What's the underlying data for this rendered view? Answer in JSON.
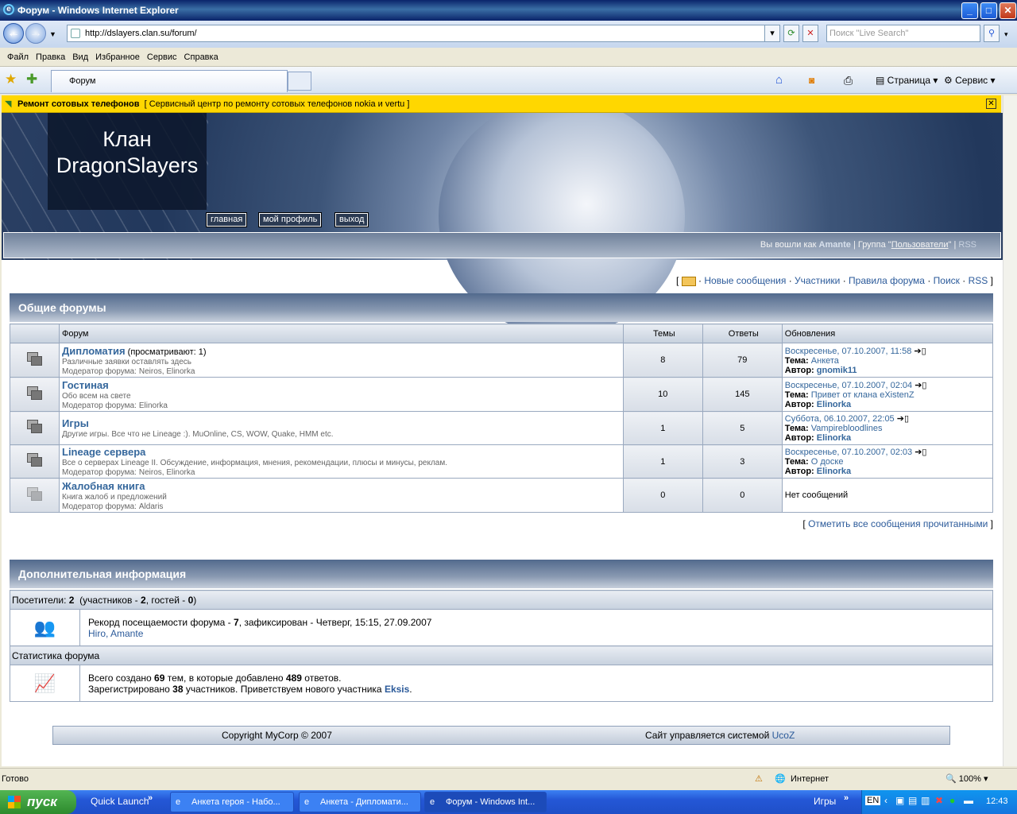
{
  "window": {
    "title": "Форум - Windows Internet Explorer"
  },
  "address": {
    "url": "http://dslayers.clan.su/forum/",
    "search_placeholder": "Поиск \"Live Search\""
  },
  "menu": [
    "Файл",
    "Правка",
    "Вид",
    "Избранное",
    "Сервис",
    "Справка"
  ],
  "tab": {
    "label": "Форум"
  },
  "toolbar": {
    "page": "Страница",
    "tools": "Сервис"
  },
  "infobar": {
    "title": "Ремонт сотовых телефонов",
    "text": "[ Сервисный центр по ремонту сотовых телефонов nokia и vertu ]"
  },
  "site": {
    "logo_line1": "Клан",
    "logo_line2": "DragonSlayers",
    "nav": [
      "главная",
      "мой профиль",
      "выход"
    ],
    "login_prefix": "Вы вошли как",
    "user": "Amante",
    "group_prefix": "| Группа \"",
    "group": "Пользователи",
    "group_suffix": "\" |",
    "rss": "RSS"
  },
  "toplinks": {
    "open": "[",
    "new": "Новые сообщения",
    "members": "Участники",
    "rules": "Правила форума",
    "search": "Поиск",
    "rss": "RSS",
    "close": "]",
    "sep": "·"
  },
  "section1": {
    "title": "Общие форумы",
    "cols": [
      "Форум",
      "Темы",
      "Ответы",
      "Обновления"
    ]
  },
  "forums": [
    {
      "title": "Дипломатия",
      "viewing": "(просматривают: 1)",
      "desc": "Различные заявки оставлять здесь",
      "mod_label": "Модератор форума:",
      "mods": "Neiros, Elinorka",
      "topics": "8",
      "replies": "79",
      "date": "Воскресенье, 07.10.2007, 11:58",
      "topic_label": "Тема:",
      "topic": "Анкета",
      "author_label": "Автор:",
      "author": "gnomik11"
    },
    {
      "title": "Гостиная",
      "viewing": "",
      "desc": "Обо всем на свете",
      "mod_label": "Модератор форума:",
      "mods": "Elinorka",
      "topics": "10",
      "replies": "145",
      "date": "Воскресенье, 07.10.2007, 02:04",
      "topic_label": "Тема:",
      "topic": "Привет от клана eXistenZ",
      "author_label": "Автор:",
      "author": "Elinorka"
    },
    {
      "title": "Игры",
      "viewing": "",
      "desc": "Другие игры. Все что не Lineage :). MuOnline, CS, WOW, Quake, HMM etc.",
      "mod_label": "",
      "mods": "",
      "topics": "1",
      "replies": "5",
      "date": "Суббота, 06.10.2007, 22:05",
      "topic_label": "Тема:",
      "topic": "Vampirebloodlines",
      "author_label": "Автор:",
      "author": "Elinorka"
    },
    {
      "title": "Lineage сервера",
      "viewing": "",
      "desc": "Все о серверах Lineage II. Обсуждение, информация, мнения, рекомендации, плюсы и минусы, реклам.",
      "mod_label": "Модератор форума:",
      "mods": "Neiros, Elinorka",
      "topics": "1",
      "replies": "3",
      "date": "Воскресенье, 07.10.2007, 02:03",
      "topic_label": "Тема:",
      "topic": "О доске",
      "author_label": "Автор:",
      "author": "Elinorka"
    },
    {
      "title": "Жалобная книга",
      "viewing": "",
      "desc": "Книга жалоб и предложений",
      "mod_label": "Модератор форума:",
      "mods": "Aldaris",
      "topics": "0",
      "replies": "0",
      "date": "",
      "topic_label": "",
      "topic": "",
      "author_label": "",
      "author": "",
      "none": "Нет сообщений"
    }
  ],
  "markread": {
    "open": "[",
    "text": "Отметить все сообщения прочитанными",
    "close": "]"
  },
  "section2": {
    "title": "Дополнительная информация",
    "visitors_label": "Посетители:",
    "visitors": "2",
    "members_label": "(участников -",
    "members": "2",
    "guests_label": ", гостей -",
    "guests": "0",
    "close": ")",
    "record_prefix": "Рекорд посещаемости форума -",
    "record": "7",
    "record_suffix": ", зафиксирован - Четверг, 15:15, 27.09.2007",
    "record_users": "Hiro, Amante",
    "stats_title": "Статистика форума",
    "stats_p1": "Всего создано",
    "topics": "69",
    "stats_p2": "тем, в которые добавлено",
    "posts": "489",
    "stats_p3": "ответов.",
    "reg_p1": "Зарегистрировано",
    "reg": "38",
    "reg_p2": "участников. Приветствуем нового участника",
    "newuser": "Eksis",
    "reg_p3": "."
  },
  "footer": {
    "copyright": "Copyright MyCorp © 2007",
    "managed": "Сайт управляется системой",
    "system": "UcoZ"
  },
  "status": {
    "text": "Готово",
    "zone": "Интернет",
    "zoom": "100%"
  },
  "taskbar": {
    "start": "пуск",
    "quicklaunch": "Quick Launch",
    "tasks": [
      "Анкета героя - Набо...",
      "Анкета - Дипломати...",
      "Форум - Windows Int..."
    ],
    "games": "Игры",
    "lang": "EN",
    "clock": "12:43"
  }
}
